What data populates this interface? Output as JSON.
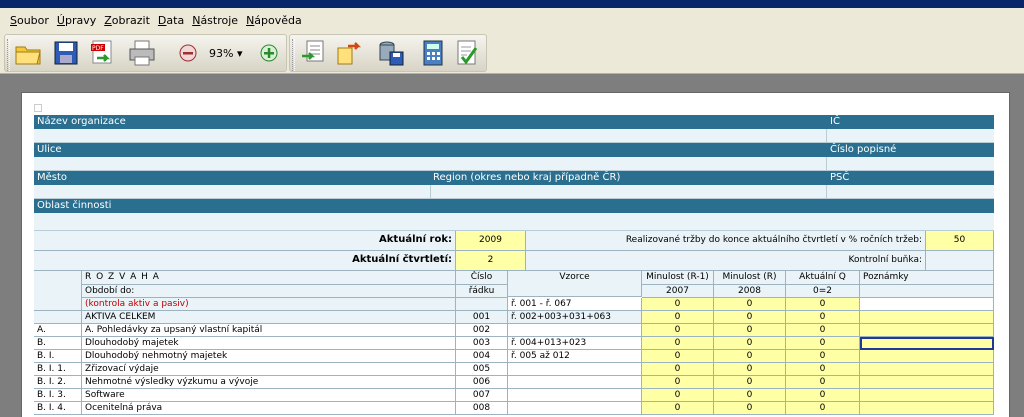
{
  "menu": [
    {
      "label": "Soubor",
      "u": "S",
      "rest": "oubor"
    },
    {
      "label": "Úpravy",
      "u": "Ú",
      "rest": "pravy"
    },
    {
      "label": "Zobrazit",
      "u": "Z",
      "rest": "obrazit"
    },
    {
      "label": "Data",
      "u": "D",
      "rest": "ata"
    },
    {
      "label": "Nástroje",
      "u": "N",
      "rest": "ástroje"
    },
    {
      "label": "Nápověda",
      "u": "N",
      "rest": "ápověda"
    }
  ],
  "toolbar": {
    "zoom": "93%",
    "icons": [
      "open-folder-icon",
      "save-icon",
      "pdf-export-icon",
      "print-icon",
      "zoom-out-icon",
      "zoom-in-icon",
      "import-icon",
      "export-icon",
      "database-save-icon",
      "calculator-icon",
      "checklist-icon"
    ]
  },
  "form": {
    "nazev_organizace": "Název organizace",
    "ic": "IČ",
    "ulice": "Ulice",
    "cislo_popisne": "Číslo popisné",
    "mesto": "Město",
    "region": "Region (okres nebo kraj případně ČR)",
    "psc": "PSČ",
    "oblast": "Oblast činnosti",
    "aktualni_rok_label": "Aktuální rok:",
    "aktualni_rok": "2009",
    "trzby_label": "Realizované tržby do konce aktuálního čtvrtletí v % ročních tržeb:",
    "trzby_value": "50",
    "ctvrtleti_label": "Aktuální čtvrtletí:",
    "ctvrtleti": "2",
    "kontrolni_label": "Kontrolní buňka:"
  },
  "table": {
    "h_rozvaha": "R O Z V A H A",
    "h_obdobi": "Období do:",
    "h_cislo1": "Číslo",
    "h_cislo2": "řádku",
    "h_vzorce": "Vzorce",
    "h_min1": "Minulost (R-1)",
    "h_min": "Minulost (R)",
    "h_akt": "Aktuální Q",
    "h_pozn": "Poznámky",
    "y1": "2007",
    "y2": "2008",
    "y3": "0=2",
    "rows": [
      {
        "code": "",
        "name": "(kontrola aktiv a pasiv)",
        "num": "",
        "formula": "ř. 001 - ř. 067",
        "v1": "0",
        "v2": "0",
        "v3": "0",
        "red": true
      },
      {
        "code": "",
        "name": "AKTIVA CELKEM",
        "num": "001",
        "formula": "ř. 002+003+031+063",
        "v1": "0",
        "v2": "0",
        "v3": "0"
      },
      {
        "code": "A.",
        "name": "A. Pohledávky za upsaný vlastní kapitál",
        "num": "002",
        "formula": "",
        "v1": "0",
        "v2": "0",
        "v3": "0"
      },
      {
        "code": "B.",
        "name": "Dlouhodobý majetek",
        "num": "003",
        "formula": "ř. 004+013+023",
        "v1": "0",
        "v2": "0",
        "v3": "0"
      },
      {
        "code": "B. I.",
        "name": "Dlouhodobý nehmotný majetek",
        "num": "004",
        "formula": "ř. 005 až 012",
        "v1": "0",
        "v2": "0",
        "v3": "0"
      },
      {
        "code": "B. I. 1.",
        "name": "Zřizovací výdaje",
        "num": "005",
        "formula": "",
        "v1": "0",
        "v2": "0",
        "v3": "0"
      },
      {
        "code": "B. I. 2.",
        "name": "Nehmotné výsledky výzkumu a vývoje",
        "num": "006",
        "formula": "",
        "v1": "0",
        "v2": "0",
        "v3": "0"
      },
      {
        "code": "B. I. 3.",
        "name": "Software",
        "num": "007",
        "formula": "",
        "v1": "0",
        "v2": "0",
        "v3": "0"
      },
      {
        "code": "B. I. 4.",
        "name": "Ocenitelná práva",
        "num": "008",
        "formula": "",
        "v1": "0",
        "v2": "0",
        "v3": "0"
      }
    ]
  }
}
